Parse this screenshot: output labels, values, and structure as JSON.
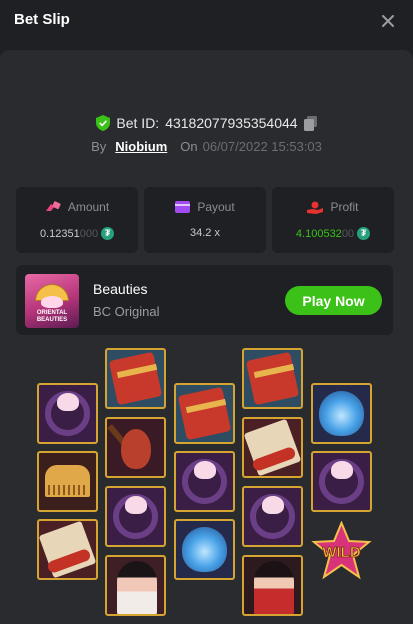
{
  "header": {
    "title": "Bet Slip"
  },
  "bet": {
    "id_label": "Bet ID:",
    "id_value": "4318207793535404​4",
    "by_label": "By",
    "user": "Niobium",
    "on_label": "On",
    "date": "06/07/2022 15:53:03"
  },
  "stats": {
    "amount": {
      "label": "Amount",
      "value_main": "0.12351",
      "value_dim": "000",
      "coin_icon": "tether-coin-icon"
    },
    "payout": {
      "label": "Payout",
      "value_main": "34.2 x"
    },
    "profit": {
      "label": "Profit",
      "value_main": "4.100532",
      "value_dim": "00",
      "coin_icon": "tether-coin-icon"
    }
  },
  "game": {
    "thumb_text_1": "ORIENTAL",
    "thumb_text_2": "BEAUTIES",
    "name": "Beauties",
    "provider": "BC Original",
    "play_label": "Play Now"
  },
  "reels": {
    "wild_label": "WILD",
    "symbols": [
      "ring",
      "comb",
      "scroll",
      "book",
      "pipa",
      "ring",
      "lady",
      "book",
      "ring",
      "lotus",
      "book",
      "scroll",
      "ring",
      "lady",
      "lotus",
      "ring",
      "wild"
    ]
  },
  "colors": {
    "accent_green": "#3bc117",
    "coin": "#26a17b",
    "tile_border": "#d6a531"
  }
}
